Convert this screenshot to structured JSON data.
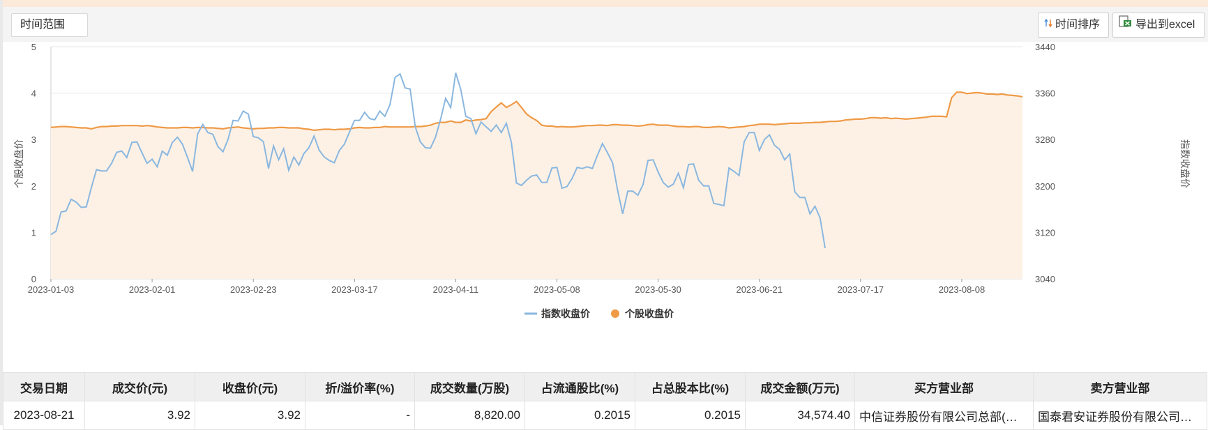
{
  "toolbar": {
    "range_label": "时间范围",
    "sort_label": "时间排序",
    "export_label": "导出到excel",
    "sort_icon": "sort-arrows-icon",
    "export_icon": "excel-file-icon"
  },
  "chart_data": {
    "type": "line",
    "colors": {
      "index": "#8ab7df",
      "stock": "#ef9a46",
      "area": "#fdf1e6"
    },
    "x_ticks": [
      "2023-01-03",
      "2023-02-01",
      "2023-02-23",
      "2023-03-17",
      "2023-04-11",
      "2023-05-08",
      "2023-05-30",
      "2023-06-21",
      "2023-07-17",
      "2023-08-08"
    ],
    "x_tick_positions": [
      0,
      20,
      40,
      60,
      80,
      100,
      120,
      140,
      160,
      180
    ],
    "ylabel_left": "个股收盘价",
    "ylabel_right": "指数收盘价",
    "y_left_ticks": [
      "0",
      "1",
      "2",
      "3",
      "4",
      "5"
    ],
    "y_right_ticks": [
      "3040",
      "3120",
      "3200",
      "3280",
      "3360",
      "3440"
    ],
    "ylim_left": [
      0,
      5
    ],
    "ylim_right": [
      3040,
      3440
    ],
    "grid": true,
    "legend_position": "bottom",
    "series": [
      {
        "name": "指数收盘价",
        "axis": "right",
        "values": [
          3116,
          3122,
          3155,
          3157,
          3177,
          3172,
          3163,
          3164,
          3197,
          3228,
          3226,
          3226,
          3239,
          3258,
          3260,
          3249,
          3275,
          3276,
          3257,
          3239,
          3246,
          3233,
          3260,
          3253,
          3275,
          3284,
          3272,
          3249,
          3225,
          3290,
          3306,
          3292,
          3289,
          3268,
          3259,
          3280,
          3313,
          3312,
          3329,
          3324,
          3285,
          3283,
          3276,
          3230,
          3269,
          3245,
          3264,
          3227,
          3250,
          3236,
          3256,
          3266,
          3286,
          3262,
          3250,
          3244,
          3240,
          3261,
          3272,
          3293,
          3313,
          3313,
          3327,
          3316,
          3314,
          3329,
          3320,
          3340,
          3387,
          3393,
          3369,
          3367,
          3302,
          3276,
          3266,
          3265,
          3284,
          3315,
          3351,
          3335,
          3395,
          3366,
          3320,
          3316,
          3290,
          3310,
          3302,
          3294,
          3305,
          3292,
          3308,
          3275,
          3205,
          3201,
          3210,
          3217,
          3219,
          3206,
          3206,
          3231,
          3232,
          3196,
          3199,
          3213,
          3232,
          3230,
          3233,
          3230,
          3253,
          3273,
          3257,
          3240,
          3192,
          3152,
          3191,
          3191,
          3184,
          3202,
          3244,
          3245,
          3224,
          3206,
          3198,
          3203,
          3222,
          3197,
          3237,
          3238,
          3210,
          3200,
          3200,
          3170,
          3168,
          3166,
          3231,
          3225,
          3218,
          3276,
          3292,
          3292,
          3261,
          3280,
          3288,
          3270,
          3263,
          3245,
          3255,
          3190,
          3180,
          3180,
          3152,
          3165,
          3145,
          3093
        ]
      },
      {
        "name": "个股收盘价",
        "axis": "left",
        "values": [
          3.26,
          3.27,
          3.28,
          3.28,
          3.27,
          3.26,
          3.25,
          3.25,
          3.23,
          3.26,
          3.28,
          3.28,
          3.29,
          3.29,
          3.3,
          3.3,
          3.3,
          3.3,
          3.29,
          3.3,
          3.29,
          3.27,
          3.26,
          3.25,
          3.25,
          3.25,
          3.26,
          3.26,
          3.25,
          3.26,
          3.26,
          3.25,
          3.25,
          3.24,
          3.23,
          3.25,
          3.26,
          3.27,
          3.25,
          3.24,
          3.23,
          3.24,
          3.24,
          3.25,
          3.25,
          3.26,
          3.26,
          3.25,
          3.25,
          3.25,
          3.23,
          3.22,
          3.2,
          3.21,
          3.22,
          3.22,
          3.21,
          3.22,
          3.22,
          3.23,
          3.25,
          3.26,
          3.25,
          3.25,
          3.26,
          3.26,
          3.28,
          3.27,
          3.27,
          3.27,
          3.27,
          3.27,
          3.28,
          3.28,
          3.29,
          3.31,
          3.35,
          3.37,
          3.37,
          3.4,
          3.37,
          3.37,
          3.42,
          3.4,
          3.42,
          3.43,
          3.45,
          3.6,
          3.7,
          3.79,
          3.69,
          3.75,
          3.82,
          3.69,
          3.55,
          3.47,
          3.41,
          3.31,
          3.29,
          3.29,
          3.27,
          3.28,
          3.27,
          3.27,
          3.28,
          3.29,
          3.3,
          3.3,
          3.31,
          3.31,
          3.3,
          3.32,
          3.32,
          3.31,
          3.31,
          3.3,
          3.29,
          3.3,
          3.32,
          3.33,
          3.31,
          3.31,
          3.31,
          3.29,
          3.28,
          3.28,
          3.27,
          3.28,
          3.28,
          3.26,
          3.26,
          3.27,
          3.28,
          3.27,
          3.25,
          3.26,
          3.27,
          3.28,
          3.3,
          3.31,
          3.33,
          3.33,
          3.33,
          3.32,
          3.33,
          3.34,
          3.35,
          3.35,
          3.35,
          3.36,
          3.36,
          3.37,
          3.37,
          3.38,
          3.39,
          3.39,
          3.4,
          3.42,
          3.43,
          3.44,
          3.44,
          3.45,
          3.47,
          3.47,
          3.46,
          3.47,
          3.45,
          3.46,
          3.45,
          3.44,
          3.45,
          3.46,
          3.47,
          3.48,
          3.5,
          3.5,
          3.5,
          3.49,
          3.9,
          4.02,
          4.02,
          3.99,
          4.0,
          4.01,
          4.0,
          3.98,
          3.98,
          3.97,
          3.98,
          3.96,
          3.95,
          3.94,
          3.92
        ]
      }
    ]
  },
  "table": {
    "headers": [
      "交易日期",
      "成交价(元)",
      "收盘价(元)",
      "折/溢价率(%)",
      "成交数量(万股)",
      "占流通股比(%)",
      "占总股本比(%)",
      "成交金额(万元)",
      "买方营业部",
      "卖方营业部"
    ],
    "rows": [
      [
        "2023-08-21",
        "3.92",
        "3.92",
        "-",
        "8,820.00",
        "0.2015",
        "0.2015",
        "34,574.40",
        "中信证券股份有限公司总部(非…",
        "国泰君安证券股份有限公司总部"
      ]
    ]
  }
}
